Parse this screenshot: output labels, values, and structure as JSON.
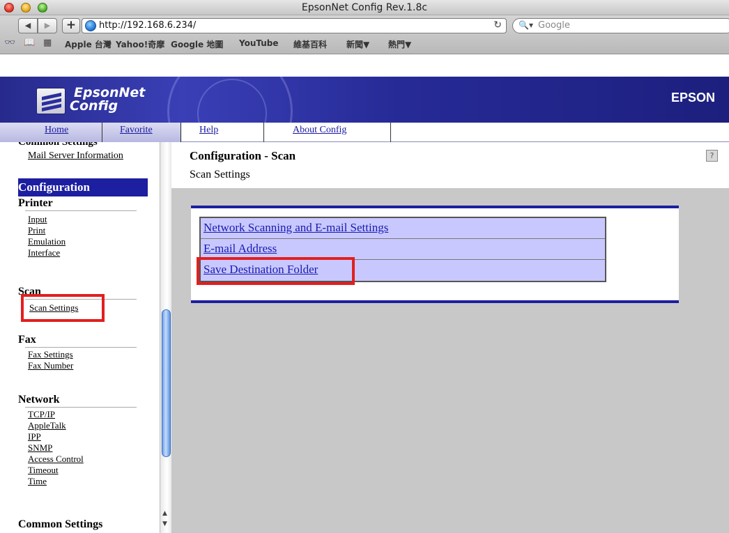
{
  "window": {
    "title": "EpsonNet Config Rev.1.8c"
  },
  "browser": {
    "url": "http://192.168.6.234/",
    "search_placeholder": "Google",
    "bookmarks": [
      "Apple 台灣",
      "Yahoo!奇摩",
      "Google 地圖",
      "YouTube",
      "維基百科",
      "新聞▼",
      "熱門▼"
    ]
  },
  "app": {
    "logo_line1": "EpsonNet",
    "logo_line2": "Config",
    "brand": "EPSON"
  },
  "topmenu": {
    "items": [
      "Home",
      "Favorite",
      "Help",
      "About Config"
    ]
  },
  "sidebar": {
    "cut_heading": "Common Settings",
    "mail_server": "Mail Server Information",
    "configuration": "Configuration",
    "printer": {
      "heading": "Printer",
      "items": [
        "Input",
        "Print",
        "Emulation",
        "Interface"
      ]
    },
    "scan": {
      "heading": "Scan",
      "items": [
        "Scan Settings"
      ]
    },
    "fax": {
      "heading": "Fax",
      "items": [
        "Fax Settings",
        "Fax Number"
      ]
    },
    "network": {
      "heading": "Network",
      "items": [
        "TCP/IP",
        "AppleTalk",
        "IPP",
        "SNMP",
        "Access Control",
        "Timeout",
        "Time"
      ]
    },
    "common": {
      "heading": "Common Settings"
    }
  },
  "content": {
    "title": "Configuration - Scan",
    "subtitle": "Scan Settings",
    "help_icon": "?",
    "links": [
      "Network Scanning and E-mail Settings",
      "E-mail Address",
      "Save Destination Folder"
    ]
  },
  "colors": {
    "epson_blue": "#1c1fa0",
    "highlight_red": "#e21f1f",
    "link_table_bg": "#c8c8ff"
  }
}
